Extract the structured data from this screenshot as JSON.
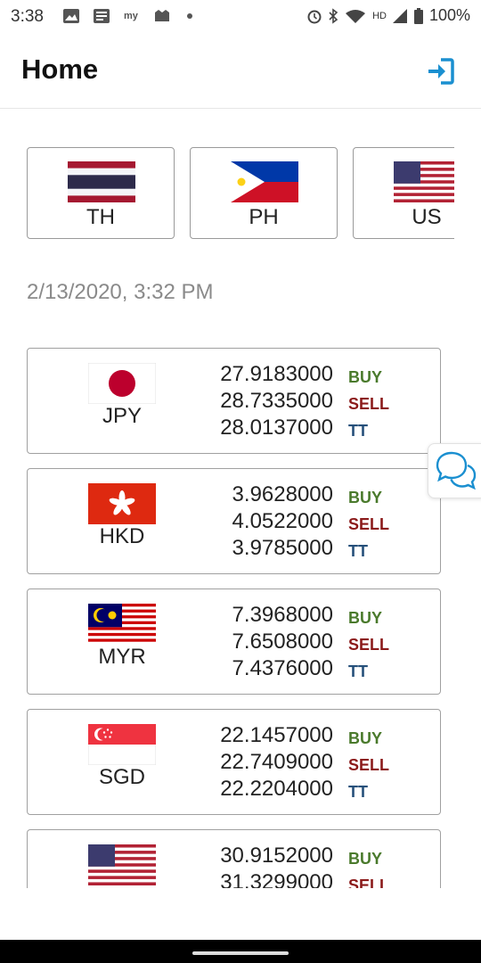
{
  "status_bar": {
    "time": "3:38",
    "network": "HD",
    "battery": "100%"
  },
  "header": {
    "title": "Home",
    "login_icon": "login-icon",
    "accent": "#1a8fd0"
  },
  "countries": [
    {
      "code": "TH",
      "flag": "thailand-flag"
    },
    {
      "code": "PH",
      "flag": "philippines-flag"
    },
    {
      "code": "US",
      "flag": "usa-flag"
    }
  ],
  "timestamp": "2/13/2020, 3:32 PM",
  "labels": {
    "buy": "BUY",
    "sell": "SELL",
    "tt": "TT"
  },
  "rates": [
    {
      "currency": "JPY",
      "flag": "japan-flag",
      "buy": "27.9183000",
      "sell": "28.7335000",
      "tt": "28.0137000"
    },
    {
      "currency": "HKD",
      "flag": "hong-kong-flag",
      "buy": "3.9628000",
      "sell": "4.0522000",
      "tt": "3.9785000"
    },
    {
      "currency": "MYR",
      "flag": "malaysia-flag",
      "buy": "7.3968000",
      "sell": "7.6508000",
      "tt": "7.4376000"
    },
    {
      "currency": "SGD",
      "flag": "singapore-flag",
      "buy": "22.1457000",
      "sell": "22.7409000",
      "tt": "22.2204000"
    },
    {
      "currency": "",
      "flag": "usa-flag",
      "buy": "30.9152000",
      "sell": "31.3299000",
      "tt": ""
    }
  ],
  "colors": {
    "buy": "#4a7a2c",
    "sell": "#8b1a1a",
    "tt": "#26507a"
  }
}
